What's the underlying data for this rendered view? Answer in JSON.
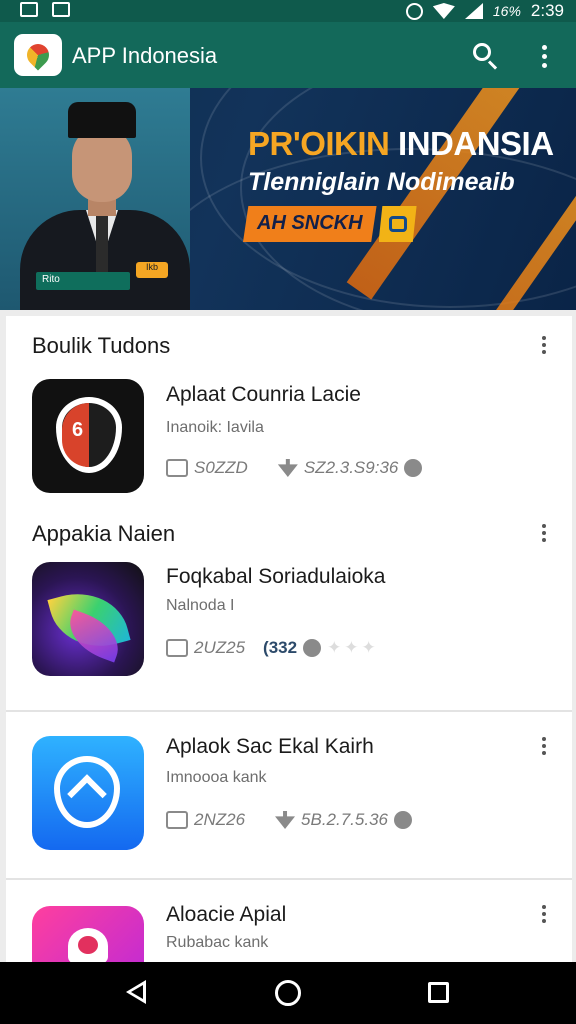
{
  "status_bar": {
    "battery": "16%",
    "time": "2:39"
  },
  "app_bar": {
    "title": "APP Indonesia"
  },
  "banner": {
    "headline_a": "PR'OIKIN",
    "headline_b": " INDANSIA",
    "subtitle": "Tlenniglain Nodimeaib",
    "cta": "AH SNCKH",
    "name_tag": "Rito",
    "badge": "Ikb"
  },
  "sections": [
    {
      "title": "Boulik Tudons"
    },
    {
      "title": "Appakia Naien"
    }
  ],
  "apps": [
    {
      "name": "Aplaat Counria Lacie",
      "developer": "Inanoik: Iavila",
      "size": "S0ZZD",
      "downloads": "SZ2.3.S9:36",
      "icon": "shield-app-icon"
    },
    {
      "name": "Foqkabal Soriadulaioka",
      "developer": "Nalnoda I",
      "size": "2UZ25",
      "downloads": "(332",
      "icon": "leaf-app-icon"
    },
    {
      "name": "Aplaok Sac Ekal Kairh",
      "developer": "Imnoooa kank",
      "size": "2NZ26",
      "downloads": "5B.2.7.5.36",
      "icon": "map-app-icon"
    },
    {
      "name": "Aloacie Apial",
      "developer": "Rubabac kank",
      "icon": "heart-app-icon"
    }
  ],
  "colors": {
    "toolbar": "#13695a",
    "status_bar": "#0f5a4c",
    "accent_orange": "#f6a623"
  }
}
